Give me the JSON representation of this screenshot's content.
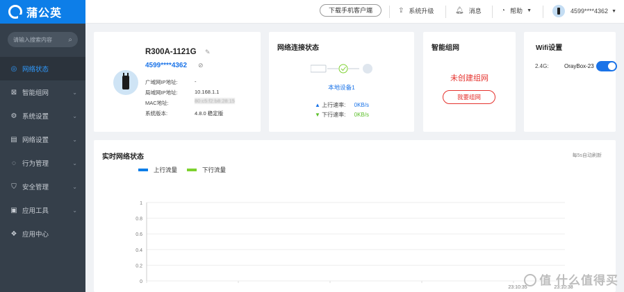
{
  "brand": {
    "name": "蒲公英"
  },
  "sidebar": {
    "search_placeholder": "请输入搜索内容",
    "items": [
      {
        "label": "网络状态",
        "icon": "network-status-icon",
        "glyph": "◎",
        "active": true
      },
      {
        "label": "智能组网",
        "icon": "mesh-icon",
        "glyph": "⊠"
      },
      {
        "label": "系统设置",
        "icon": "settings-icon",
        "glyph": "⚙"
      },
      {
        "label": "网络设置",
        "icon": "network-settings-icon",
        "glyph": "▤"
      },
      {
        "label": "行为管理",
        "icon": "behavior-icon",
        "glyph": "◌"
      },
      {
        "label": "安全管理",
        "icon": "security-icon",
        "glyph": "⛉"
      },
      {
        "label": "应用工具",
        "icon": "tools-icon",
        "glyph": "▣"
      },
      {
        "label": "应用中心",
        "icon": "app-center-icon",
        "glyph": "❖"
      }
    ]
  },
  "topbar": {
    "download_app": "下载手机客户端",
    "upgrade": "系统升级",
    "messages": "消息",
    "help": "帮助",
    "account": "4599****4362"
  },
  "device": {
    "name": "R300A-1121G",
    "id": "4599****4362",
    "wan_ip_label": "广域网IP地址:",
    "wan_ip_value": "-",
    "lan_ip_label": "局域网IP地址:",
    "lan_ip_value": "10.168.1.1",
    "mac_label": "MAC地址:",
    "mac_value": "80:c5:f2:b8:28:15",
    "version_label": "系统版本:",
    "version_value": "4.8.0 稳定版"
  },
  "network_status": {
    "title": "网络连接状态",
    "link_text": "本地设备1",
    "up_label": "上行速率:",
    "up_value": "0KB/s",
    "down_label": "下行速率:",
    "down_value": "0KB/s"
  },
  "mesh": {
    "title": "智能组网",
    "status": "未创建组网",
    "button": "我要组网"
  },
  "wifi": {
    "title": "Wifi设置",
    "band": "2.4G:",
    "ssid": "OrayBox-23",
    "enabled": true
  },
  "realtime": {
    "title": "实时网络状态",
    "refresh_note": "每5s自动刷新"
  },
  "colors": {
    "up": "#0d7ee8",
    "down": "#7dd12f",
    "accent": "#1a73e8",
    "danger": "#e5322d"
  },
  "chart_data": {
    "type": "line",
    "series": [
      {
        "name": "上行流量",
        "color": "#0d7ee8",
        "values": []
      },
      {
        "name": "下行流量",
        "color": "#7dd12f",
        "values": []
      }
    ],
    "y_ticks": [
      "0",
      "0.2",
      "0.4",
      "0.6",
      "0.8",
      "1"
    ],
    "ylim": [
      0,
      1
    ],
    "x_ticks": [
      "23:10:35",
      "23:10:38"
    ],
    "grid": true,
    "legend": "top-left"
  },
  "watermark": "值 什么值得买"
}
